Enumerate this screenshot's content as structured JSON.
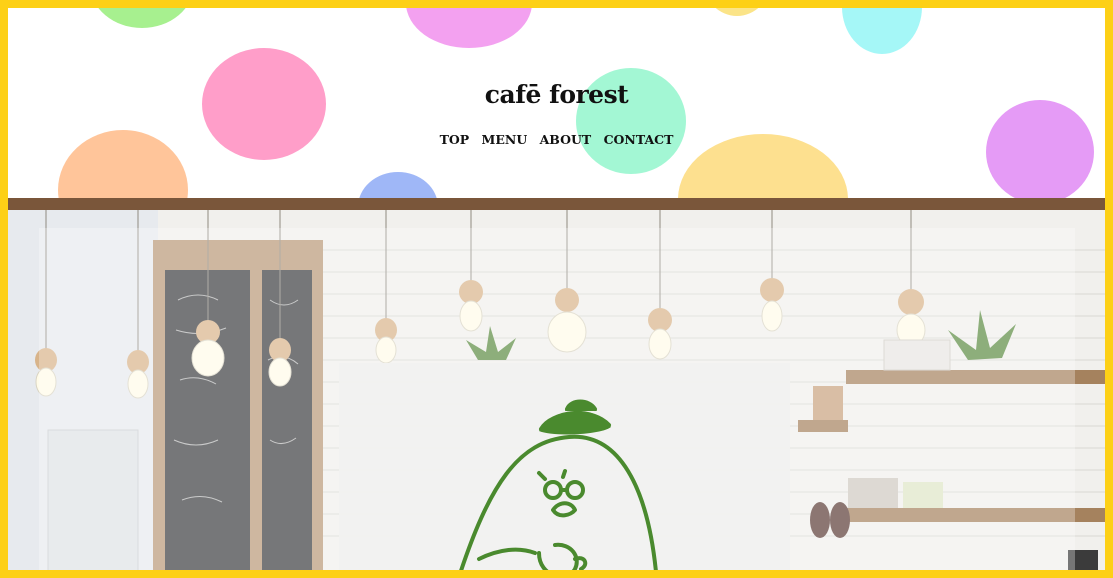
{
  "site": {
    "logo": "cafē forest"
  },
  "nav": {
    "items": [
      {
        "label": "TOP"
      },
      {
        "label": "MENU"
      },
      {
        "label": "ABOUT"
      },
      {
        "label": "CONTACT"
      }
    ]
  },
  "colors": {
    "frame": "#fdd016",
    "divider_bar": "#7a563a",
    "mascot_line": "#4a8a2e",
    "dots": [
      "#a7f08f",
      "#f3a1f0",
      "#fbe488",
      "#a5f7f7",
      "#ff9ec9",
      "#a3f7d4",
      "#ffc59a",
      "#9fb7f7",
      "#fde08f",
      "#e59bf6"
    ]
  },
  "icons": {
    "hero_image": "cafe-interior-photo",
    "mascot": "bird-with-hat-mascot-icon"
  }
}
